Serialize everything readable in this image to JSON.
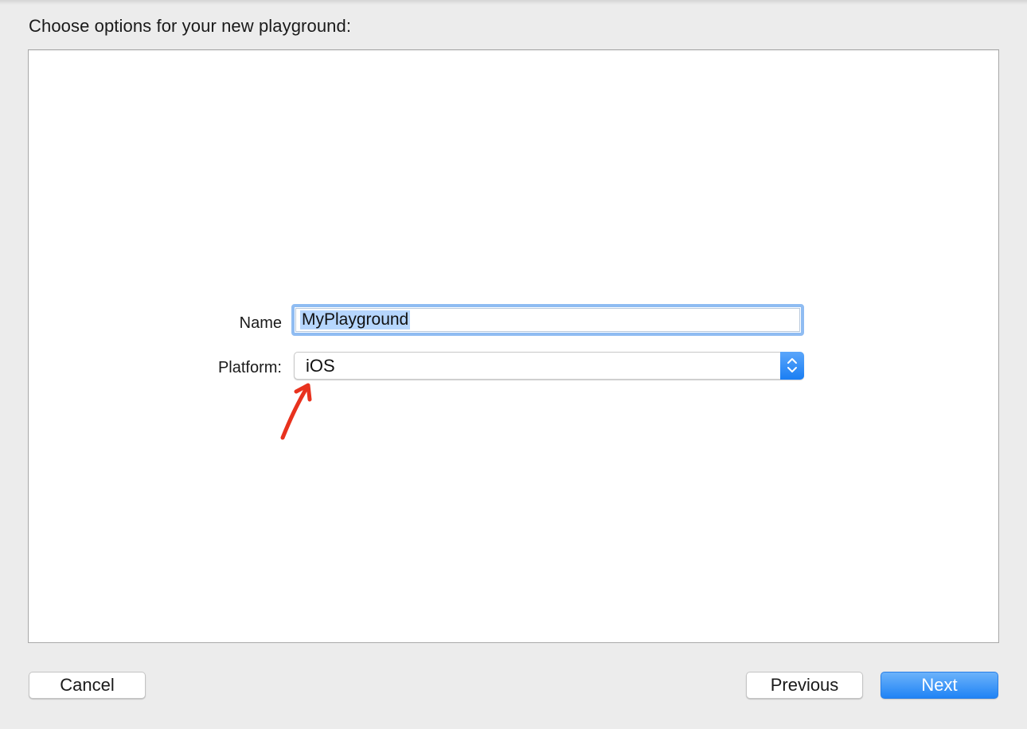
{
  "dialog": {
    "header": "Choose options for your new playground:"
  },
  "form": {
    "name_label": "Name",
    "name_value": "MyPlayground",
    "platform_label": "Platform:",
    "platform_value": "iOS"
  },
  "buttons": {
    "cancel": "Cancel",
    "previous": "Previous",
    "next": "Next"
  },
  "annotation": {
    "arrow_color": "#e8321e",
    "icon": "red-arrow-icon"
  },
  "colors": {
    "accent": "#1f83f5",
    "selection": "#b6d6fd",
    "focus_ring": "#8fbcf2"
  }
}
